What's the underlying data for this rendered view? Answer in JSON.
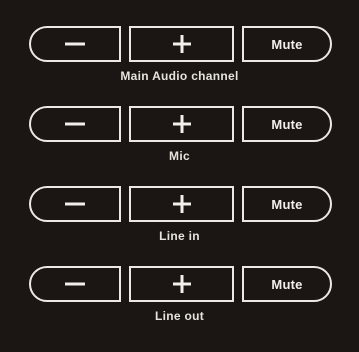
{
  "controls": [
    {
      "minus_icon": "minus-icon",
      "plus_icon": "plus-icon",
      "mute_label": "Mute",
      "channel_label": "Main Audio channel"
    },
    {
      "minus_icon": "minus-icon",
      "plus_icon": "plus-icon",
      "mute_label": "Mute",
      "channel_label": "Mic"
    },
    {
      "minus_icon": "minus-icon",
      "plus_icon": "plus-icon",
      "mute_label": "Mute",
      "channel_label": "Line in"
    },
    {
      "minus_icon": "minus-icon",
      "plus_icon": "plus-icon",
      "mute_label": "Mute",
      "channel_label": "Line out"
    }
  ],
  "colors": {
    "background": "#1b1613",
    "outline": "#ece8e2",
    "text": "#e6e2dc"
  }
}
